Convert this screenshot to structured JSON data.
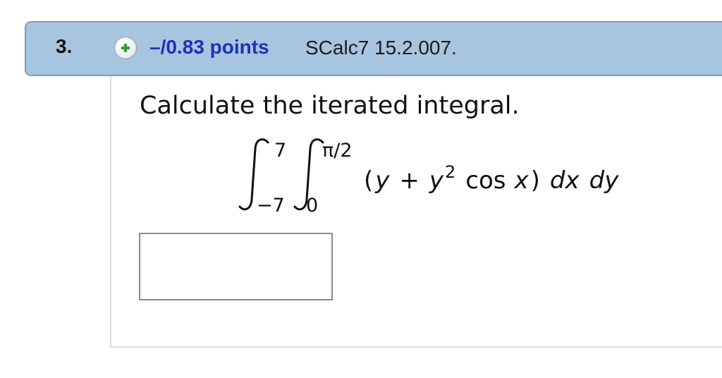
{
  "question": {
    "number": "3.",
    "points": "–/0.83 points",
    "source": "SCalc7 15.2.007.",
    "prompt": "Calculate the iterated integral.",
    "integral": {
      "outer_upper": "7",
      "outer_lower": "−7",
      "inner_upper": "π/2",
      "inner_lower": "0",
      "integrand": {
        "open_paren": "(",
        "y1": "y",
        "plus": "+",
        "y2": "y",
        "exponent": "2",
        "cos": "cos",
        "x": "x",
        "close_paren": ")",
        "dx": "dx",
        "dy": "dy"
      }
    },
    "answer_value": ""
  },
  "icons": {
    "expand": "plus-circle-icon"
  },
  "colors": {
    "header_bg": "#a8c5e0",
    "points_text": "#1b32b8",
    "plus_icon": "#2aa02a"
  }
}
